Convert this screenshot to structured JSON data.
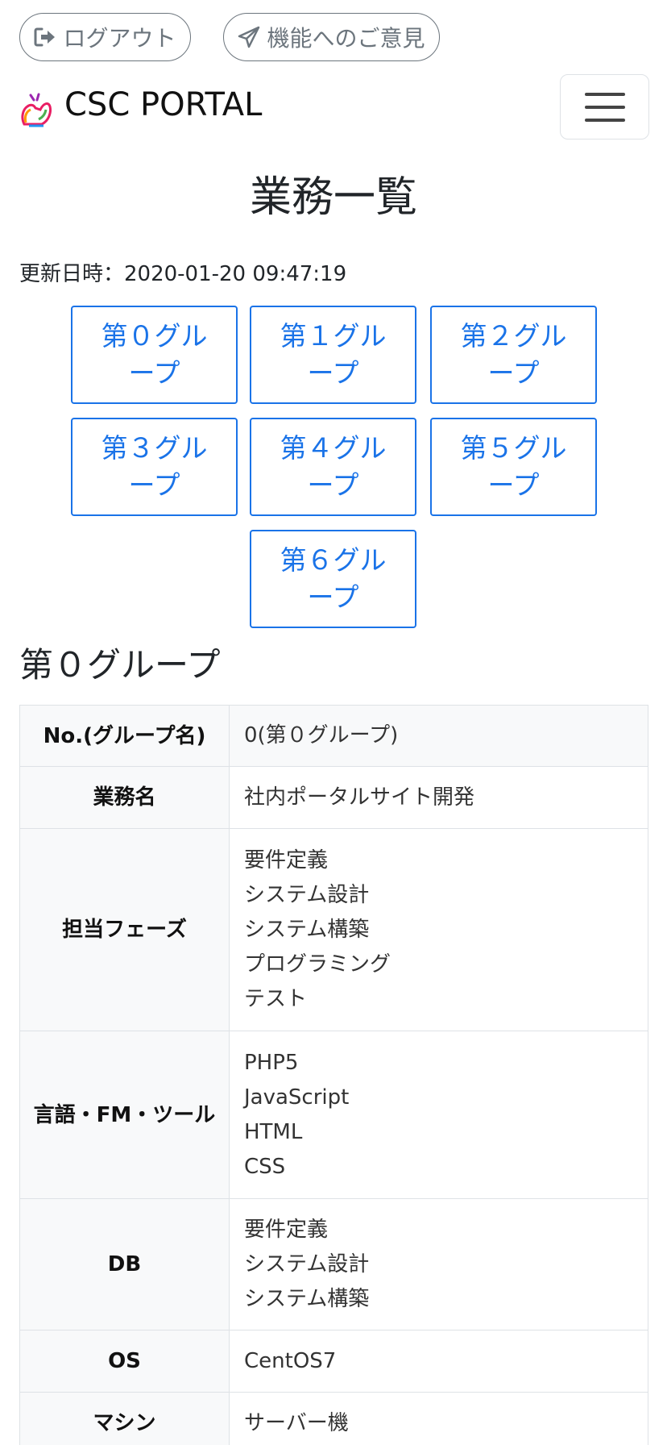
{
  "header": {
    "logout_label": "ログアウト",
    "feedback_label": "機能へのご意見",
    "brand": "CSC PORTAL"
  },
  "page": {
    "title": "業務一覧",
    "updated": "更新日時：2020-01-20 09:47:19"
  },
  "groups": [
    {
      "label": "第０グループ"
    },
    {
      "label": "第１グループ"
    },
    {
      "label": "第２グループ"
    },
    {
      "label": "第３グループ"
    },
    {
      "label": "第４グループ"
    },
    {
      "label": "第５グループ"
    },
    {
      "label": "第６グループ"
    }
  ],
  "detail": {
    "title": "第０グループ",
    "rows": [
      {
        "label": "No.(グループ名)",
        "values": [
          "0(第０グループ)"
        ]
      },
      {
        "label": "業務名",
        "values": [
          "社内ポータルサイト開発"
        ]
      },
      {
        "label": "担当フェーズ",
        "values": [
          "要件定義",
          "システム設計",
          "システム構築",
          "プログラミング",
          "テスト"
        ]
      },
      {
        "label": "言語・FM・ツール",
        "values": [
          "PHP5",
          "JavaScript",
          "HTML",
          "CSS"
        ]
      },
      {
        "label": "DB",
        "values": [
          "要件定義",
          "システム設計",
          "システム構築"
        ]
      },
      {
        "label": "OS",
        "values": [
          "CentOS7"
        ]
      },
      {
        "label": "マシン",
        "values": [
          "サーバー機"
        ]
      }
    ]
  },
  "colors": {
    "accent": "#1a73e8",
    "pill_border": "#6c757d",
    "header_cell_bg": "#f8f9fa"
  },
  "icons": {
    "logout": "sign-out-icon",
    "feedback": "paper-plane-icon",
    "menu": "hamburger-menu-icon",
    "logo": "flexed-arm-logo"
  }
}
